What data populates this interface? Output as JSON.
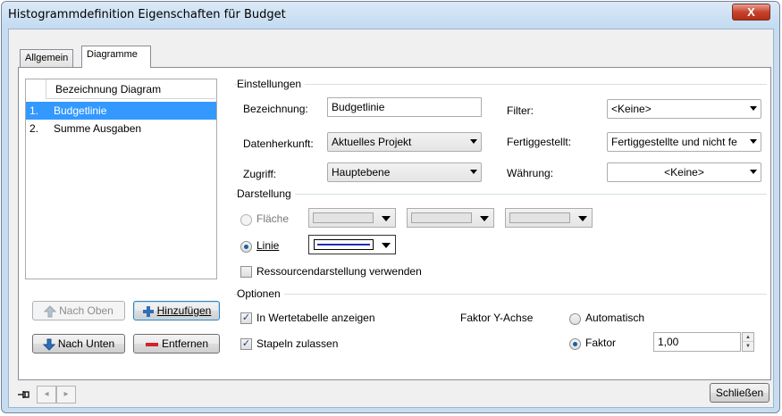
{
  "window": {
    "title": "Histogrammdefinition Eigenschaften für Budget",
    "close_label": "X"
  },
  "tabs": [
    {
      "label": "Allgemein"
    },
    {
      "label": "Diagramme"
    }
  ],
  "list": {
    "header": "Bezeichnung Diagram",
    "items": [
      {
        "num": "1.",
        "label": "Budgetlinie",
        "selected": true
      },
      {
        "num": "2.",
        "label": "Summe Ausgaben",
        "selected": false
      }
    ]
  },
  "list_buttons": {
    "nach_oben": "Nach Oben",
    "hinzufuegen": "Hinzufügen",
    "nach_unten": "Nach Unten",
    "entfernen": "Entfernen"
  },
  "einstellungen": {
    "group": "Einstellungen",
    "bezeichnung_label": "Bezeichnung:",
    "bezeichnung_value": "Budgetlinie",
    "datenherkunft_label": "Datenherkunft:",
    "datenherkunft_value": "Aktuelles Projekt",
    "zugriff_label": "Zugriff:",
    "zugriff_value": "Hauptebene",
    "filter_label": "Filter:",
    "filter_value": "<Keine>",
    "fertiggestellt_label": "Fertiggestellt:",
    "fertiggestellt_value": "Fertiggestellte und nicht fe",
    "waehrung_label": "Währung:",
    "waehrung_value": "<Keine>"
  },
  "darstellung": {
    "group": "Darstellung",
    "flaeche_label": "Fläche",
    "linie_label": "Linie",
    "line_color": "#1e2fb4",
    "ressourcen_label": "Ressourcendarstellung verwenden"
  },
  "optionen": {
    "group": "Optionen",
    "wertetabelle_label": "In Wertetabelle anzeigen",
    "stapeln_label": "Stapeln zulassen",
    "faktor_y_label": "Faktor Y-Achse",
    "automatisch_label": "Automatisch",
    "faktor_label": "Faktor",
    "faktor_value": "1,00"
  },
  "footer": {
    "close_button": "Schließen"
  }
}
